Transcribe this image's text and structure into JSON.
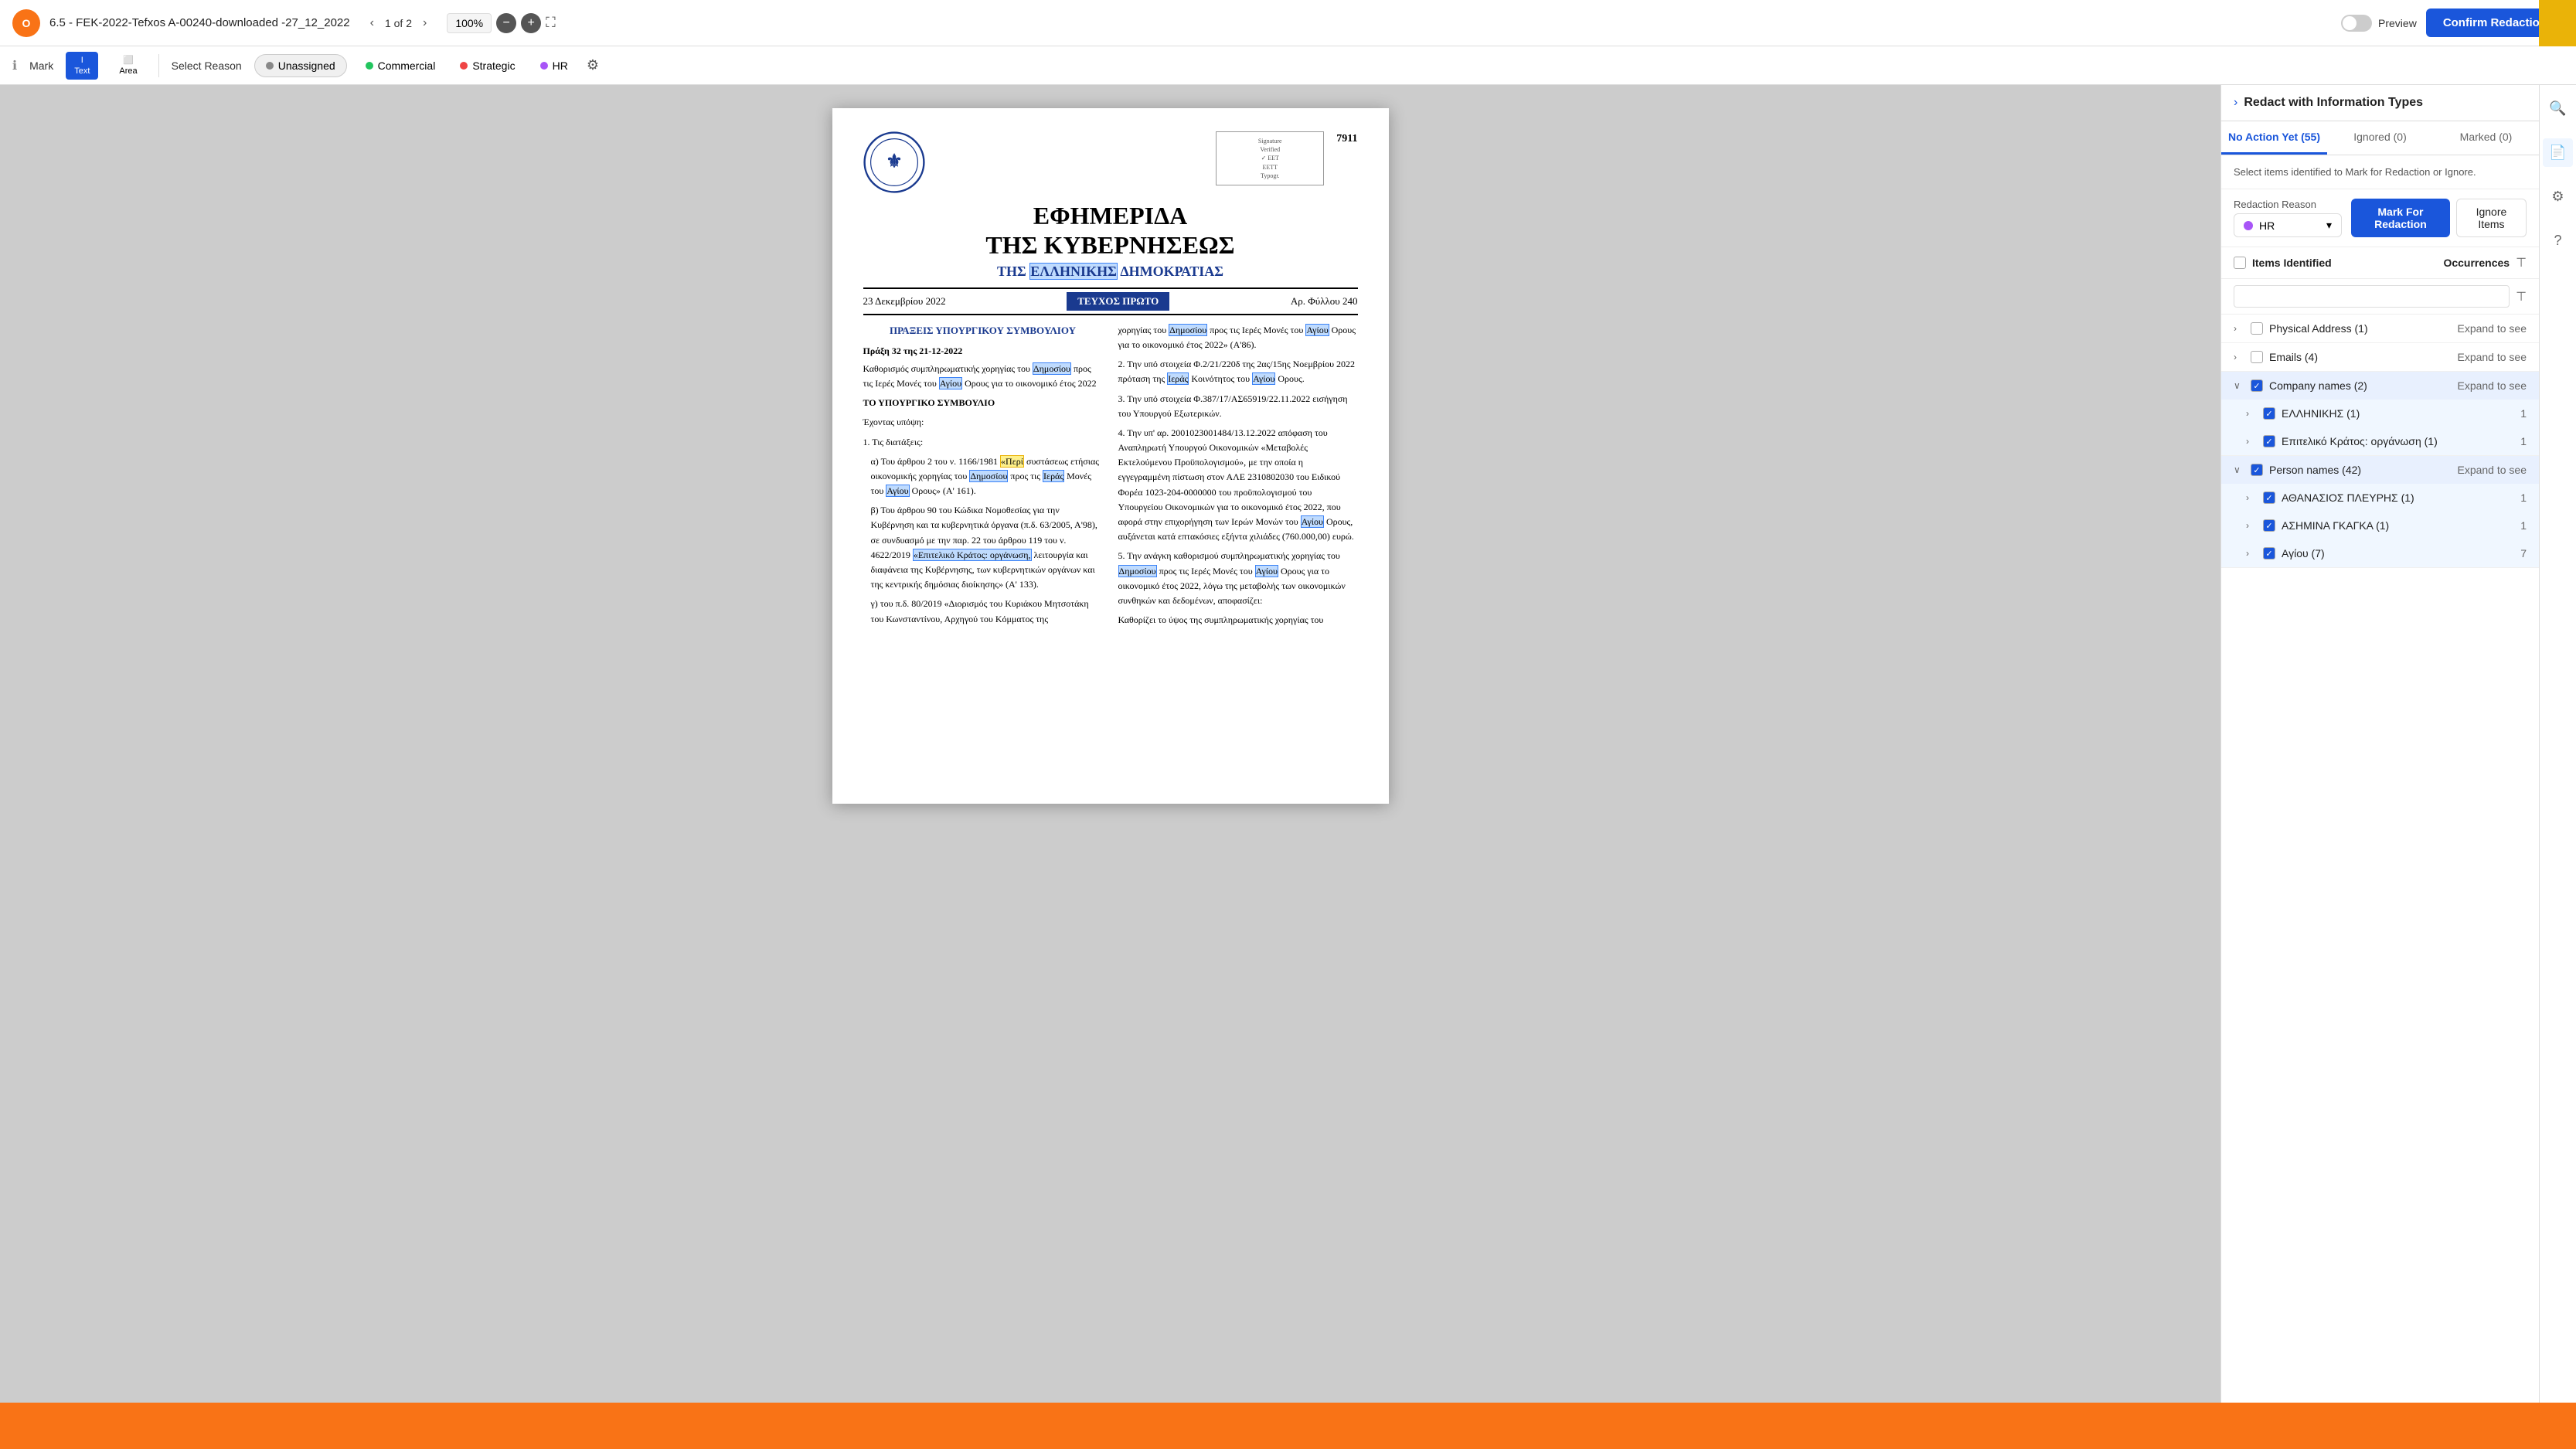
{
  "app": {
    "icon": "O",
    "file_name": "6.5 - FEK-2022-Tefxos A-00240-downloaded -27_12_2022",
    "page_current": "1",
    "page_total": "2",
    "zoom": "100%",
    "confirm_btn": "Confirm Redaction",
    "preview_label": "Preview"
  },
  "secondary_toolbar": {
    "mark_label": "Mark",
    "text_tool": "Text",
    "area_tool": "Area",
    "select_reason": "Select Reason",
    "unassigned": "Unassigned",
    "commercial": "Commercial",
    "strategic": "Strategic",
    "hr": "HR"
  },
  "document": {
    "number": "7911",
    "title_main": "ΕΦΗΜΕΡΙΔΑ\nΤΗΣ ΚΥΒΕΡΝΗΣΕΩΣ",
    "title_sub": "ΤΗΣ ΕΛΛΗΝΙΚΗΣ ΔΗΜΟΚΡΑΤΙΑΣ",
    "date": "23 Δεκεμβρίου 2022",
    "issue_tag": "ΤΕΥΧΟΣ ΠΡΩΤΟ",
    "issue_number": "Αρ. Φύλλου 240",
    "section_title": "ΠΡΑΞΕΙΣ ΥΠΟΥΡΓΙΚΟΥ ΣΥΜΒΟΥΛΙΟΥ",
    "act_title": "Πράξη 32 της 21-12-2022",
    "body_text_left": "Καθορισμός συμπληρωματικής χορηγίας του Δημοσίου προς τις Ιερές Μονές του Αγίου Ορους για το οικονομικό έτος 2022\n\nΤΟ ΥΠΟΥΡΓΙΚΟ ΣΥΜΒΟΥΛΙΟ\n\nΈχοντας υπόψη:\n1. Τις διατάξεις:\nα) Του άρθρου 2 του ν. 1166/1981 «Περί συστάσεως ετήσιας οικονομικής χορηγίας του Δημοσίου προς τις Ιερές Μονές του Αγίου Ορους» (Α' 161).\nβ) Του άρθρου 90 του Κώδικα Νομοθεσίας για την Κυβέρνηση και τα κυβερνητικά όργανα (π.δ. 63/2005, Α'98), σε συνδυασμό με την παρ. 22 του άρθρου 119 του ν. 4622/2019 «Επιτελικό Κράτος: οργάνωση, λειτουργία και διαφάνεια της Κυβέρνησης, των κυβερνητικών οργάνων και της κεντρικής δημόσιας διοίκησης» (Α' 133).\nγ) του π.δ. 80/2019 «Διορισμός του Κυριάκου Μητσοτάκη του Κωνσταντίνου, Αρχηγού του Κόμματος της",
    "body_text_right": "χορηγίας του Δημοσίου προς τις Ιερές Μονές του Αγίου Ορους για το οικονομικό έτος 2022» (Α'86).\n2. Την υπό στοιχεία Φ.2/21/220δ της 2ας/15ης Νοεμβρίου 2022 πρόταση της Ιεράς Κοινότητος του Αγίου Ορους.\n3. Την υπό στοιχεία Φ.387/17/ΑΣ65919/22.11.2022 εισήγηση του Υπουργού Εξωτερικών.\n4. Την υπ' αρ. 2001023001484/13.12.2022 απόφαση του Αναπληρωτή Υπουργού Οικονομικών «Μεταβολές Εκτελούμενου Προϋπολογισμού», με την οποία η εγγεγραμμένη πίστωση στον ΑΛΕ 2310802030 του Ειδικού Φορέα 1023-204-0000000 του προϋπολογισμού του Υπουργείου Οικονομικών για το οικονομικό έτος 2022, που αφορά στην επιχορήγηση των Ιερών Μονών του Αγίου Ορους, αυξάνεται κατά επτακόσιες εξήντα χιλιάδες (760.000,00) ευρώ.\n5. Την ανάγκη καθορισμού συμπληρωματικής χορηγίας του Δημοσίου προς τις Ιερές Μονές του Αγίου Ορους για το οικονομικό έτος 2022, λόγω της μεταβολής των οικονομικών συνθηκών και δεδομένων, αποφασίζει:\nΚαθορίζει το ύψος της συμπληρωματικής χορηγίας του"
  },
  "right_panel": {
    "title": "Redact with Information Types",
    "tabs": [
      {
        "label": "No Action Yet (55)",
        "active": true
      },
      {
        "label": "Ignored (0)",
        "active": false
      },
      {
        "label": "Marked (0)",
        "active": false
      }
    ],
    "description": "Select items identified to Mark for Redaction or Ignore.",
    "redaction_reason_label": "Redaction Reason",
    "redaction_reason_value": "HR",
    "mark_btn": "Mark For Redaction",
    "ignore_btn": "Ignore Items",
    "items_header": "Items Identified",
    "occurrences_header": "Occurrences",
    "search_placeholder": "",
    "items": [
      {
        "name": "Physical Address (1)",
        "count": "Expand to see",
        "expanded": false,
        "checked": false,
        "sub_items": []
      },
      {
        "name": "Emails (4)",
        "count": "Expand to see",
        "expanded": false,
        "checked": false,
        "sub_items": []
      },
      {
        "name": "Company names (2)",
        "count": "Expand to see",
        "expanded": true,
        "checked": true,
        "sub_items": [
          {
            "name": "ΕΛΛΗΝΙΚΗΣ (1)",
            "count": "1",
            "checked": true
          },
          {
            "name": "Επιτελικό Κράτος: οργάνωση (1)",
            "count": "1",
            "checked": true
          }
        ]
      },
      {
        "name": "Person names (42)",
        "count": "Expand to see",
        "expanded": true,
        "checked": true,
        "sub_items": [
          {
            "name": "ΑΘΑΝΑΣΙΟΣ ΠΛΕΥΡΗΣ (1)",
            "count": "1",
            "checked": true
          },
          {
            "name": "ΑΣΗΜΙΝΑ ΓΚΑΓΚΑ (1)",
            "count": "1",
            "checked": true
          },
          {
            "name": "Αγίου (7)",
            "count": "7",
            "checked": true
          }
        ]
      }
    ]
  }
}
